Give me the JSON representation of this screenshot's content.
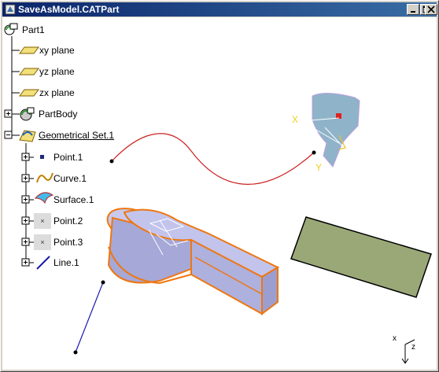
{
  "window": {
    "title": "SaveAsModel.CATPart",
    "buttons": [
      "minimize",
      "maximize",
      "close"
    ]
  },
  "tree": {
    "root": "Part1",
    "items": [
      {
        "label": "xy plane",
        "icon": "plane-icon"
      },
      {
        "label": "yz plane",
        "icon": "plane-icon"
      },
      {
        "label": "zx plane",
        "icon": "plane-icon"
      },
      {
        "label": "PartBody",
        "icon": "partbody-icon"
      },
      {
        "label": "Geometrical Set.1",
        "icon": "geometrical-set-icon"
      },
      {
        "label": "Point.1",
        "icon": "point-icon"
      },
      {
        "label": "Curve.1",
        "icon": "curve-icon"
      },
      {
        "label": "Surface.1",
        "icon": "surface-icon"
      },
      {
        "label": "Point.2",
        "icon": "point-icon"
      },
      {
        "label": "Point.3",
        "icon": "point-icon"
      },
      {
        "label": "Line.1",
        "icon": "line-icon"
      }
    ]
  },
  "axes": {
    "plane_x_label": "X",
    "plane_y_label": "Y",
    "compass_x": "x",
    "compass_z": "z"
  },
  "colors": {
    "title_start": "#0a246a",
    "title_end": "#3a6ea5",
    "curve": "#cc2020",
    "solid_fill": "#b7b9e3",
    "solid_edge": "#ee7711",
    "surface_fill": "#9aa878",
    "patch_fill": "#8fb3c9",
    "line": "#1a1ab0"
  }
}
